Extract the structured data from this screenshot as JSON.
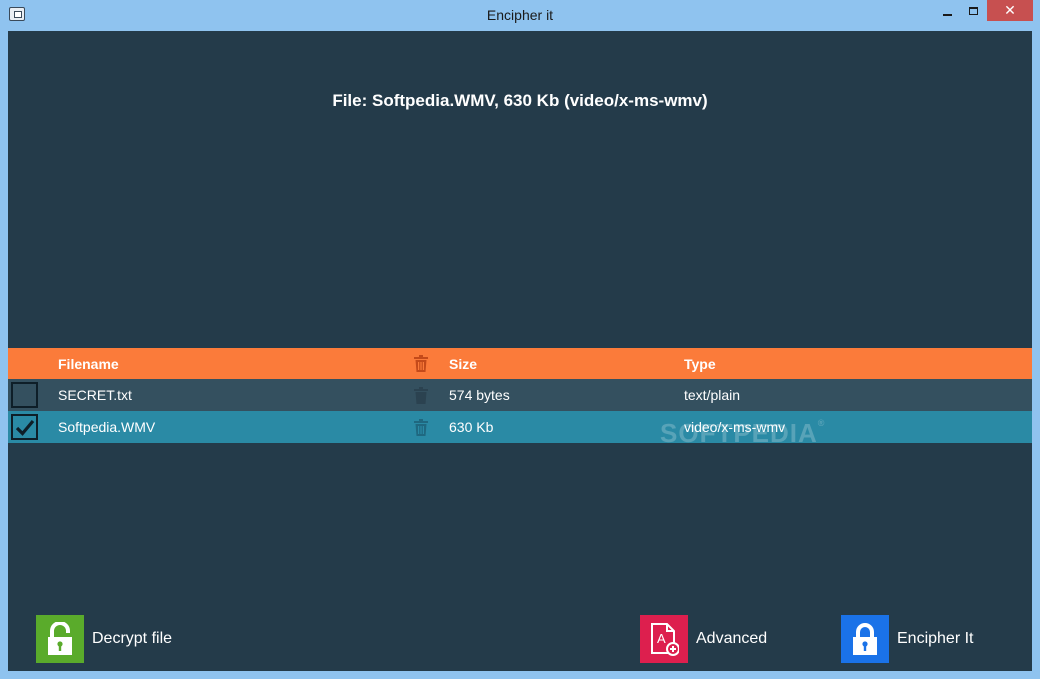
{
  "window": {
    "title": "Encipher it",
    "close_glyph": "✕"
  },
  "file_info": "File: Softpedia.WMV, 630 Kb (video/x-ms-wmv)",
  "table": {
    "headers": {
      "filename": "Filename",
      "size": "Size",
      "type": "Type",
      "delete_icon": "trash-icon"
    },
    "rows": [
      {
        "filename": "SECRET.txt",
        "size": "574 bytes",
        "type": "text/plain",
        "checked": false
      },
      {
        "filename": "Softpedia.WMV",
        "size": "630 Kb",
        "type": "video/x-ms-wmv",
        "checked": true
      }
    ]
  },
  "watermark": "SOFTPEDIA",
  "actions": {
    "decrypt": {
      "label": "Decrypt file",
      "icon": "unlocked-padlock-icon",
      "color": "#5aab2b"
    },
    "advanced": {
      "label": "Advanced",
      "icon": "document-settings-icon",
      "color": "#dd1f4e"
    },
    "encipher": {
      "label": "Encipher It",
      "icon": "locked-padlock-icon",
      "color": "#1a72e8"
    }
  },
  "colors": {
    "background": "#243b4a",
    "header": "#fb7b3a",
    "row_selected": "#2a8aa5",
    "row_normal": "#34505f"
  }
}
